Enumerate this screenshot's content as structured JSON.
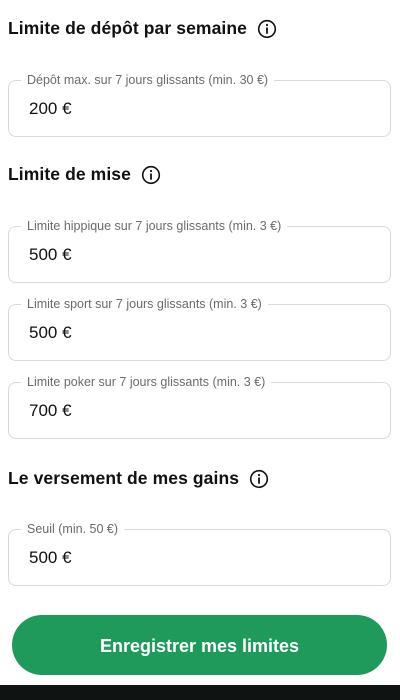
{
  "sections": {
    "deposit": {
      "title": "Limite de dépôt par semaine",
      "fields": [
        {
          "label": "Dépôt max. sur 7 jours glissants (min. 30 €)",
          "value": "200 €"
        }
      ]
    },
    "bet": {
      "title": "Limite de mise",
      "fields": [
        {
          "label": "Limite hippique sur 7 jours glissants (min. 3 €)",
          "value": "500 €"
        },
        {
          "label": "Limite sport sur 7 jours glissants (min. 3 €)",
          "value": "500 €"
        },
        {
          "label": "Limite poker sur 7 jours glissants (min. 3 €)",
          "value": "700 €"
        }
      ]
    },
    "payout": {
      "title": "Le versement de mes gains",
      "fields": [
        {
          "label": "Seuil (min. 50 €)",
          "value": "500 €"
        }
      ]
    }
  },
  "icons": {
    "info": "info-icon"
  },
  "cta": {
    "label": "Enregistrer mes limites"
  },
  "colors": {
    "accent": "#1f9a5b",
    "field_border": "#d9d9d9",
    "label_text": "#6b6b6b",
    "bottom_bar": "#0f1412"
  }
}
